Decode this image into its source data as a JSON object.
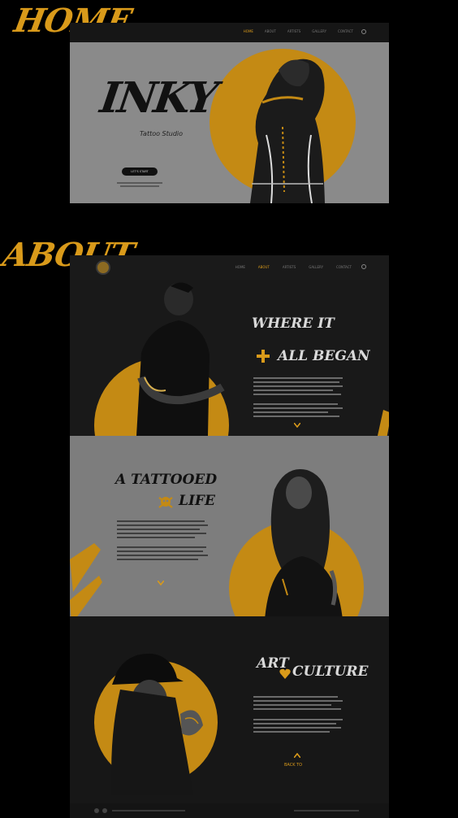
{
  "labels": {
    "home": "HOME",
    "about": "ABOUT"
  },
  "home": {
    "nav": {
      "links": [
        "HOME",
        "ABOUT",
        "ARTISTS",
        "GALLERY",
        "CONTACT"
      ],
      "active_index": 0
    },
    "brand": {
      "name": "INKY",
      "subtitle": "Tattoo Studio"
    },
    "cta_label": "LET'S START"
  },
  "about": {
    "nav": {
      "links": [
        "HOME",
        "ABOUT",
        "ARTISTS",
        "GALLERY",
        "CONTACT"
      ],
      "active_index": 1
    },
    "sections": [
      {
        "heading_line1": "WHERE IT",
        "heading_line2": "ALL BEGAN"
      },
      {
        "heading_line1": "A TATTOOED",
        "heading_line2": "LIFE"
      },
      {
        "heading_line1": "ART",
        "heading_line2": "CULTURE"
      }
    ],
    "back_label": "BACK TO"
  },
  "colors": {
    "accent": "#d99a1a",
    "circle": "#c48a14",
    "dark": "#191919",
    "gray": "#7d7d7d"
  }
}
